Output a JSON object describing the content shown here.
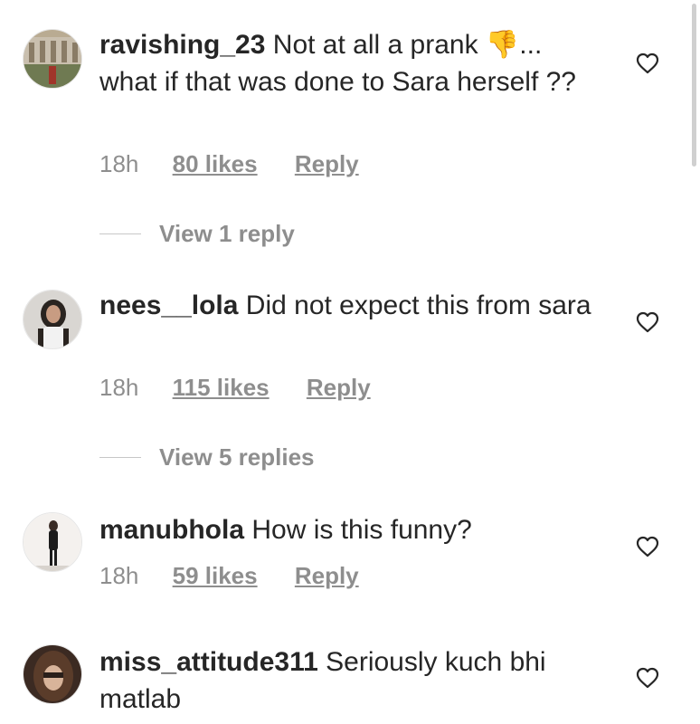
{
  "comments": [
    {
      "username": "ravishing_23",
      "text": "Not at all a prank",
      "emoji": "👎",
      "text_after_emoji": "... what if that was done to Sara herself ??",
      "time": "18h",
      "likes": "80 likes",
      "reply": "Reply",
      "view_replies": "View 1 reply"
    },
    {
      "username": "nees__lola",
      "text": "Did not expect this from sara",
      "time": "18h",
      "likes": "115 likes",
      "reply": "Reply",
      "view_replies": "View 5 replies"
    },
    {
      "username": "manubhola",
      "text": "How is this funny?",
      "time": "18h",
      "likes": "59 likes",
      "reply": "Reply"
    },
    {
      "username": "miss_attitude311",
      "text": "Seriously kuch bhi matlab"
    }
  ],
  "colors": {
    "text": "#262626",
    "muted": "#8e8e8e",
    "divider": "#c7c7c7"
  },
  "icons": {
    "like": "heart-outline-icon",
    "emoji": "thumbs-down-emoji"
  }
}
